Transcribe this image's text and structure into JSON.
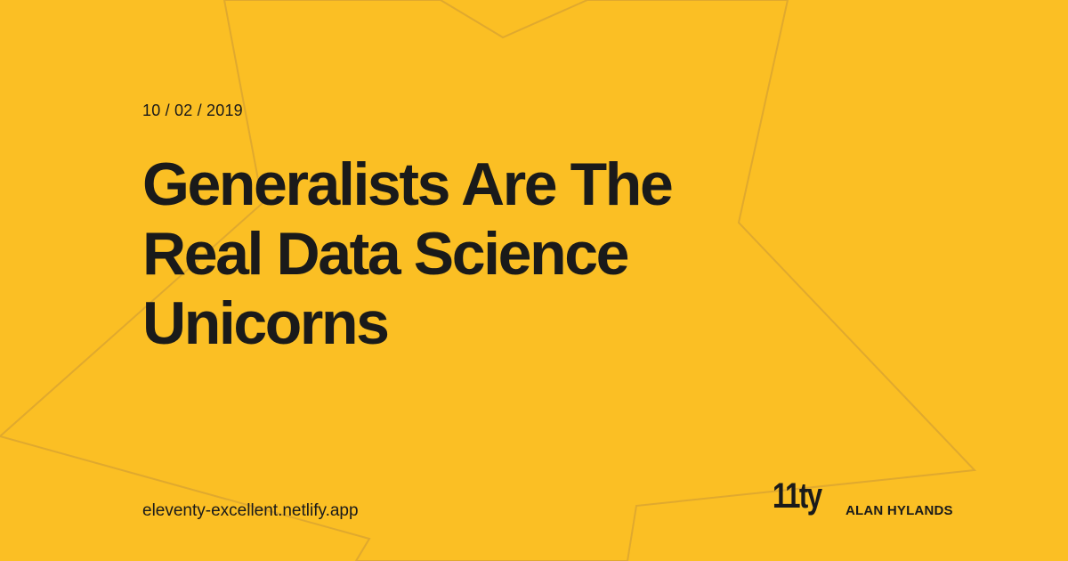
{
  "colors": {
    "background": "#FBBF24",
    "text": "#1A1A1A",
    "outline": "#E0A92E"
  },
  "post": {
    "date": "10 / 02 / 2019",
    "title_lines": [
      "Generalists Are The",
      "Real Data Science",
      "Unicorns"
    ]
  },
  "footer": {
    "site_url": "eleventy-excellent.netlify.app",
    "logo_text": "11ty",
    "author": "ALAN HYLANDS"
  },
  "decorations": {
    "background_shape": "star-outline"
  }
}
